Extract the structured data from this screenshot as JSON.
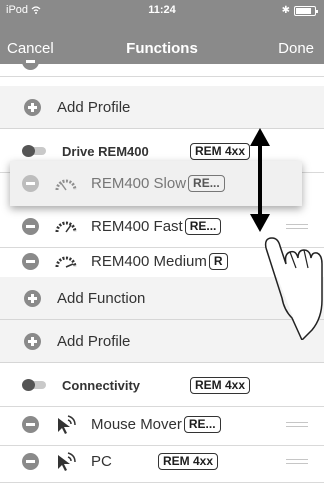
{
  "status": {
    "carrier": "iPod",
    "time": "11:24"
  },
  "nav": {
    "cancel": "Cancel",
    "title": "Functions",
    "done": "Done"
  },
  "rows": {
    "add_profile_1": "Add Profile",
    "drive_group": {
      "label": "Drive REM400",
      "badge": "REM 4xx"
    },
    "slow": {
      "label": "REM400 Slow",
      "badge": "RE..."
    },
    "fast": {
      "label": "REM400 Fast",
      "badge": "RE..."
    },
    "medium": {
      "label": "REM400 Medium",
      "badge": "R"
    },
    "add_function": "Add Function",
    "add_profile_2": "Add Profile",
    "connectivity_group": {
      "label": "Connectivity",
      "badge": "REM 4xx"
    },
    "mouse_mover": {
      "label": "Mouse Mover",
      "badge": "RE..."
    },
    "pc": {
      "label": "PC",
      "badge": "REM 4xx"
    }
  },
  "icons": {
    "wifi": "wifi-icon",
    "bluetooth": "bluetooth-icon",
    "battery": "battery-icon",
    "speedometer": "speedometer-icon",
    "pointer_wireless": "pointer-wireless-icon",
    "reorder": "reorder-handle-icon",
    "toggle": "toggle-icon",
    "drag_arrow": "vertical-arrow-icon",
    "hand": "hand-gesture-icon"
  },
  "colors": {
    "header": "#8a8a8a",
    "row_bg": "#ffffff",
    "separator_bg": "#f3f3f3",
    "icon_gray": "#8a8a8a"
  }
}
